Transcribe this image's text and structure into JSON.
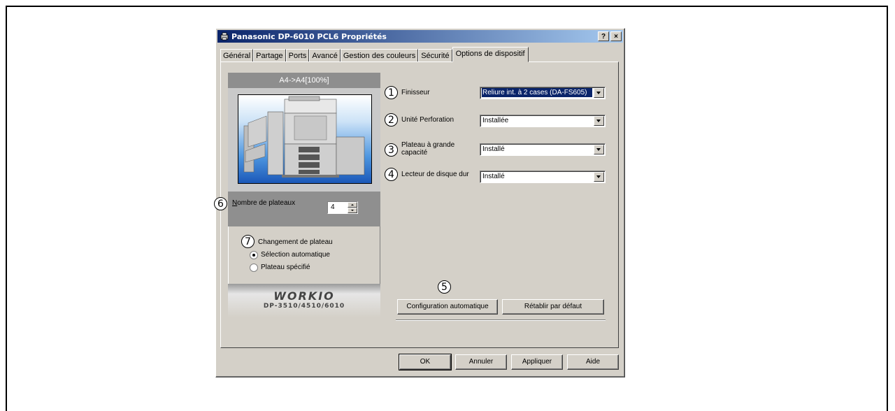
{
  "window": {
    "title": "Panasonic DP-6010 PCL6 Propriétés",
    "help_btn": "?",
    "close_btn": "×"
  },
  "tabs": [
    {
      "label": "Général"
    },
    {
      "label": "Partage"
    },
    {
      "label": "Ports"
    },
    {
      "label": "Avancé"
    },
    {
      "label": "Gestion des couleurs"
    },
    {
      "label": "Sécurité"
    },
    {
      "label": "Options de dispositif"
    }
  ],
  "preview": {
    "paper_label": "A4->A4[100%]"
  },
  "callouts": [
    "1",
    "2",
    "3",
    "4",
    "5",
    "6",
    "7"
  ],
  "options": {
    "finisher": {
      "label": "Finisseur",
      "value": "Reliure int. à 2 cases (DA-FS605)"
    },
    "punch": {
      "label": "Unité Perforation",
      "value": "Installée"
    },
    "lcc_line1": "Plateau à grande",
    "lcc_line2": "capacité",
    "lcc_value": "Installé",
    "hdd": {
      "label": "Lecteur de disque dur",
      "value": "Installé"
    }
  },
  "trays": {
    "label": "Nombre de plateaux",
    "value": "4"
  },
  "tray_change": {
    "title": "Changement de plateau",
    "auto": "Sélection automatique",
    "specified": "Plateau spécifié"
  },
  "logo": {
    "main": "WORKIO",
    "sub": "DP-3510/4510/6010"
  },
  "buttons": {
    "auto_config": "Configuration automatique",
    "reset": "Rétablir par défaut",
    "ok": "OK",
    "cancel": "Annuler",
    "apply": "Appliquer",
    "help": "Aide"
  }
}
